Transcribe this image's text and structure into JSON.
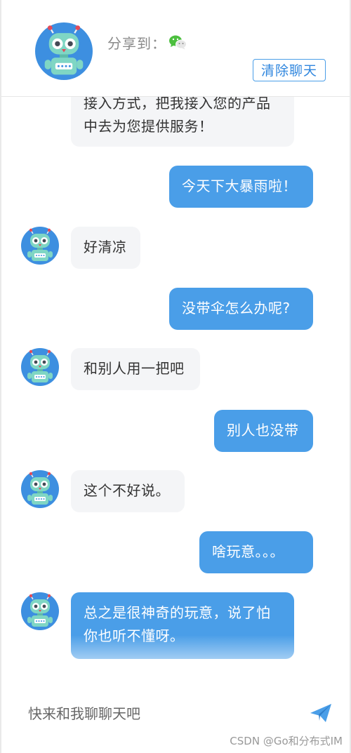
{
  "header": {
    "share_label": "分享到：",
    "share_icon": "wechat-icon",
    "clear_button_label": "清除聊天"
  },
  "messages": [
    {
      "role": "bot",
      "text": "接入方式，把我接入您的产品中去为您提供服务！"
    },
    {
      "role": "user",
      "text": "今天下大暴雨啦！"
    },
    {
      "role": "bot",
      "text": "好清凉"
    },
    {
      "role": "user",
      "text": "没带伞怎么办呢?"
    },
    {
      "role": "bot",
      "text": "和别人用一把吧"
    },
    {
      "role": "user",
      "text": "别人也没带"
    },
    {
      "role": "bot",
      "text": "这个不好说。"
    },
    {
      "role": "user",
      "text": "啥玩意。。。"
    },
    {
      "role": "bot",
      "text": "总之是很神奇的玩意，说了怕你也听不懂呀。"
    }
  ],
  "input": {
    "placeholder": "快来和我聊聊天吧",
    "value": ""
  },
  "send_icon": "send-icon",
  "watermark": "CSDN @Go和分布式IM",
  "colors": {
    "accent": "#4a9ee8",
    "bot_bubble": "#f4f5f7",
    "bot_text": "#333333",
    "user_text": "#ffffff",
    "robot_face": "#7fd6c4",
    "avatar_bg": "#3d8fe0"
  }
}
